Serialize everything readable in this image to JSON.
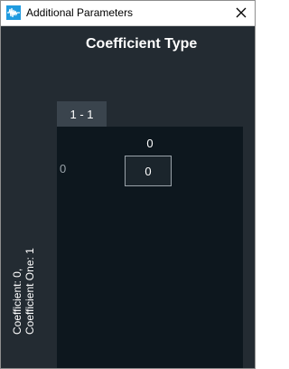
{
  "window": {
    "title": "Additional Parameters",
    "app_icon": "waveform-icon",
    "close_icon": "close-icon"
  },
  "main": {
    "heading": "Coefficient Type",
    "tab_label": "1 - 1",
    "column_header": "0",
    "row_header": "0",
    "cell_value": "0",
    "vertical_label_line1": "Coefficient: 0,",
    "vertical_label_line2": "Coefficient One: 1"
  },
  "colors": {
    "background": "#232b32",
    "panel": "#0d171e",
    "tab": "#3a444d",
    "accent": "#1f9be0"
  }
}
